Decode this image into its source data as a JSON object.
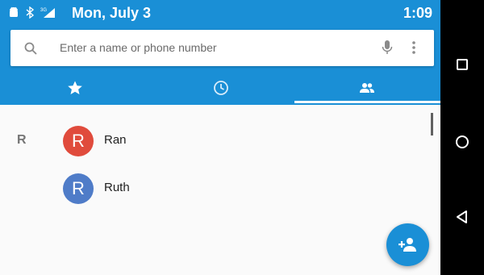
{
  "status_bar": {
    "date": "Mon, July 3",
    "time": "1:09",
    "icons": [
      "android-icon",
      "bluetooth-icon",
      "signal-3g-icon"
    ]
  },
  "search": {
    "placeholder": "Enter a name or phone number"
  },
  "tabs": [
    {
      "icon": "star-icon",
      "name": "favorites",
      "selected": false
    },
    {
      "icon": "clock-icon",
      "name": "recents",
      "selected": false
    },
    {
      "icon": "people-icon",
      "name": "contacts",
      "selected": true
    }
  ],
  "contacts": {
    "section_letter": "R",
    "items": [
      {
        "initial": "R",
        "name": "Ran",
        "avatar_color": "#e04b3c"
      },
      {
        "initial": "R",
        "name": "Ruth",
        "avatar_color": "#4f7cc8"
      }
    ]
  },
  "fab": {
    "icon": "add-contact-icon"
  },
  "nav_bar": [
    "recents-square-icon",
    "home-circle-icon",
    "back-triangle-icon"
  ],
  "colors": {
    "primary": "#1a8fd6",
    "background": "#fafafa"
  }
}
